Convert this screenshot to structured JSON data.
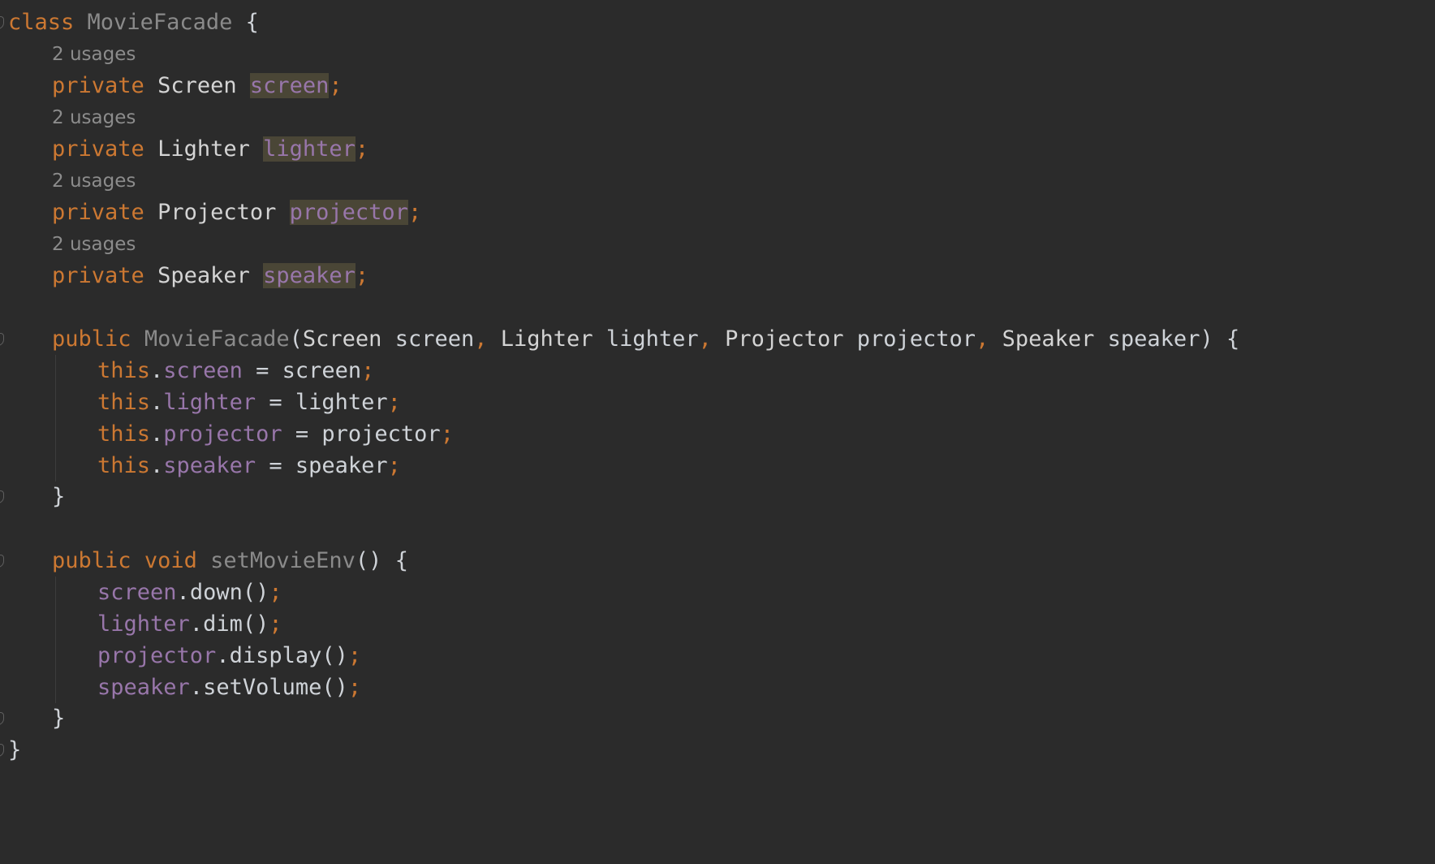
{
  "code": {
    "class_kw": "class",
    "class_name": "MovieFacade",
    "open_brace": "{",
    "close_brace": "}",
    "usage_hint": "2 usages",
    "private_kw": "private",
    "public_kw": "public",
    "void_kw": "void",
    "this_kw": "this",
    "semicolon": ";",
    "dot": ".",
    "comma": ",",
    "assign": " = ",
    "fields": [
      {
        "type": "Screen",
        "name": "screen"
      },
      {
        "type": "Lighter",
        "name": "lighter"
      },
      {
        "type": "Projector",
        "name": "projector"
      },
      {
        "type": "Speaker",
        "name": "speaker"
      }
    ],
    "constructor_name": "MovieFacade",
    "method_name": "setMovieEnv",
    "empty_parens": "()",
    "calls": [
      {
        "target": "screen",
        "method": "down()"
      },
      {
        "target": "lighter",
        "method": "dim()"
      },
      {
        "target": "projector",
        "method": "display()"
      },
      {
        "target": "speaker",
        "method": "setVolume()"
      }
    ]
  }
}
